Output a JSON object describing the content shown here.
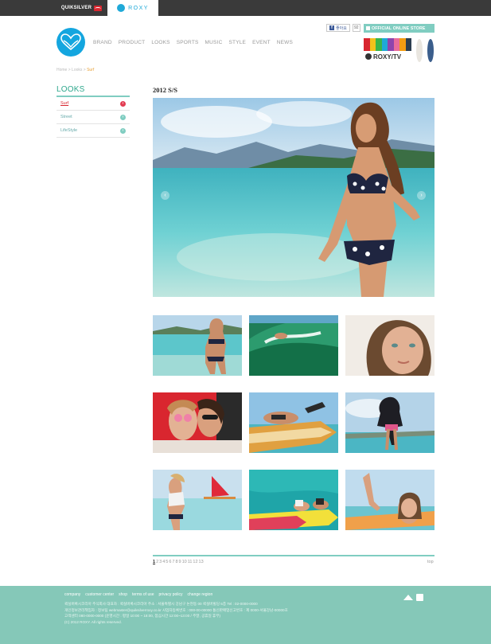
{
  "topbar": {
    "quiksilver_label": "QUIKSILVER",
    "roxy_label": "ROXY"
  },
  "header": {
    "nav": [
      "BRAND",
      "PRODUCT",
      "LOOKS",
      "SPORTS",
      "MUSIC",
      "STYLE",
      "EVENT",
      "NEWS"
    ],
    "facebook_label": "좋아요",
    "like_count": "92",
    "store_label": "OFFICIAL ONLINE STORE",
    "roxytv_label": "ROXY/TV",
    "tv_bar_colors": [
      "#d8262f",
      "#f2c21b",
      "#3ab54a",
      "#1fa9d8",
      "#8e44ad",
      "#e96b9b",
      "#f39c12",
      "#2c3e50"
    ]
  },
  "breadcrumb": {
    "home": "Home",
    "sep": ">",
    "section": "Looks",
    "current": "Surf"
  },
  "sidebar": {
    "title": "LOOKS",
    "items": [
      {
        "label": "Surf",
        "active": true
      },
      {
        "label": "Street",
        "active": false
      },
      {
        "label": "LifeStyle",
        "active": false
      }
    ]
  },
  "main": {
    "season": "2012 S/S",
    "prev_glyph": "‹",
    "next_glyph": "›"
  },
  "pager": {
    "pages": [
      "1",
      "2",
      "3",
      "4",
      "5",
      "6",
      "7",
      "8",
      "9",
      "10",
      "11",
      "12",
      "13"
    ],
    "current": "1",
    "top_label": "top"
  },
  "footer": {
    "links": [
      "company",
      "customer center",
      "shop",
      "terms of use",
      "privacy policy",
      "change region"
    ],
    "info": [
      "퀵실버록시코리아 주식회사 대표자 : 퀵실버록시코리아 주소 : 서울특별시 강남구 논현동 00 퀵실버빌딩 5층 Tel : 02-0000-0000",
      "개인정보관리책임자 : 정보팀 webmaster@quiksilverroxy.co.kr 사업자등록번호 : 000-00-00000 통신판매업신고번호 : 제 0000-서울강남-00000호",
      "고객센터 080-0000-0000 (운영시간 : 평일 10:00 ~ 18:00, 점심시간 12:00~13:00 / 주말, 공휴일 휴무)",
      "(C) 2012 ROXY. All rights reserved."
    ]
  },
  "colors": {
    "accent": "#80cdc1",
    "roxy_blue": "#14a6df",
    "topbar": "#3a3a3a",
    "footer": "#85c8b8",
    "active_red": "#d8262f"
  }
}
